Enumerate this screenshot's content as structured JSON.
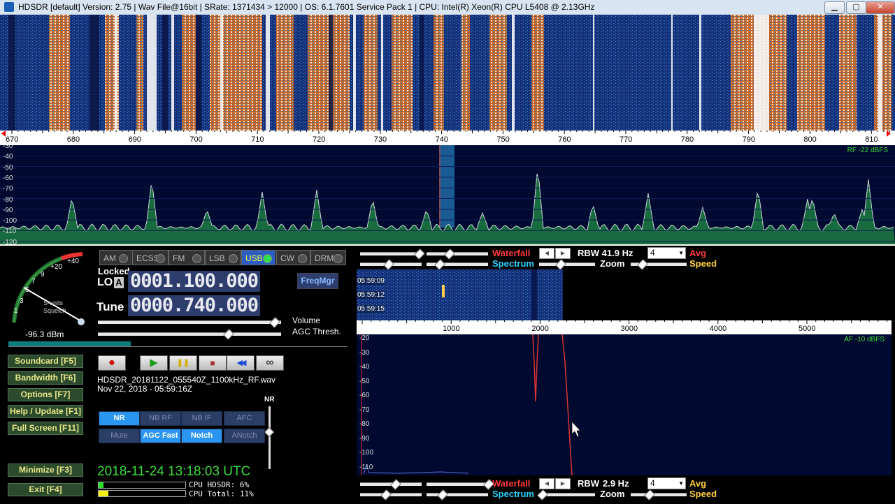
{
  "window": {
    "title": "HDSDR  [default]  Version: 2.75   |  Wav File@16bit  |  SRate: 1371434 > 12000   |  OS: 6.1.7601  Service Pack 1   |  CPU: Intel(R) Xeon(R) CPU          L5408  @ 2.13GHz",
    "min_label": "▁",
    "max_label": "▢",
    "close_label": "✕"
  },
  "freq_axis": {
    "ticks": [
      "670",
      "680",
      "690",
      "700",
      "710",
      "720",
      "730",
      "740",
      "750",
      "760",
      "770",
      "780",
      "790",
      "800",
      "810"
    ],
    "first_label": "670"
  },
  "spectrum": {
    "y_labels": [
      "-30",
      "-40",
      "-50",
      "-60",
      "-70",
      "-80",
      "-90",
      "-100",
      "-110",
      "-120"
    ],
    "rf_level": "RF -22 dBFS"
  },
  "smeter": {
    "scale": [
      "1",
      "3",
      "5",
      "7",
      "9",
      "+20",
      "+40"
    ],
    "caption_units": "S-units",
    "caption_squelch": "Squelch",
    "dbm": "-96.3 dBm"
  },
  "modes": [
    {
      "label": "AM",
      "active": false
    },
    {
      "label": "ECSS",
      "active": false
    },
    {
      "label": "FM",
      "active": false
    },
    {
      "label": "LSB",
      "active": false
    },
    {
      "label": "USB",
      "active": true
    },
    {
      "label": "CW",
      "active": false
    },
    {
      "label": "DRM",
      "active": false
    }
  ],
  "lo": {
    "status": "Locked",
    "label": "LO",
    "badge": "A",
    "value": "0001.100.000"
  },
  "tune": {
    "label": "Tune",
    "value": "0000.740.000"
  },
  "freqmgr": "FreqMgr",
  "volume_label": "Volume",
  "agc_label": "AGC Thresh.",
  "nav": [
    {
      "label": "Soundcard  [F5]"
    },
    {
      "label": "Bandwidth  [F6]"
    },
    {
      "label": "Options   [F7]"
    },
    {
      "label": "Help / Update  [F1]"
    },
    {
      "label": "Full Screen  [F11]"
    },
    {
      "label": "Minimize  [F3]"
    },
    {
      "label": "Exit      [F4]"
    }
  ],
  "transport": {
    "rec": "●",
    "play": "▶",
    "pause": "❚❚",
    "stop": "■",
    "rew": "◀◀",
    "loop": "∞"
  },
  "file": {
    "name": "HDSDR_20181122_055540Z_1100kHz_RF.wav",
    "time": "Nov 22, 2018 - 05:59:16Z"
  },
  "nr_label": "NR",
  "filters": [
    {
      "label": "NR",
      "on": true
    },
    {
      "label": "NB RF",
      "on": false
    },
    {
      "label": "NB IF",
      "on": false
    },
    {
      "label": "AFC",
      "on": false
    },
    {
      "label": "Mute",
      "on": false
    },
    {
      "label": "AGC Fast",
      "on": true
    },
    {
      "label": "Notch",
      "on": true
    },
    {
      "label": "ANotch",
      "on": false
    }
  ],
  "clock": "2018-11-24   13:18:03 UTC",
  "cpu": {
    "hdsdr_label": "CPU HDSDR:  6%",
    "total_label": "CPU Total:  11%",
    "hdsdr": 0.06,
    "total": 0.11
  },
  "rf_controls": {
    "waterfall": "Waterfall",
    "spectrum": "Spectrum",
    "rbw": "RBW 41.9 Hz",
    "zoom": "Zoom",
    "avg": "Avg",
    "speed": "Speed",
    "dropdown": "4"
  },
  "af_waterfall_times": [
    "05:59:09",
    "05:59:12",
    "05:59:15"
  ],
  "af_axis": [
    "1000",
    "2000",
    "3000",
    "4000",
    "5000"
  ],
  "af_spectrum": {
    "y_labels": [
      "-20",
      "-30",
      "-40",
      "-50",
      "-60",
      "-70",
      "-80",
      "-90",
      "-100",
      "-110"
    ],
    "af_level": "AF -10 dBFS"
  },
  "af_controls": {
    "waterfall": "Waterfall",
    "spectrum": "Spectrum",
    "rbw_label": "RBW",
    "rbw_value": "2.9 Hz",
    "zoom": "Zoom",
    "avg": "Avg",
    "speed": "Speed",
    "dropdown": "4"
  },
  "colors": {
    "accent": "#2a96f2",
    "spectrum_bg": "#000a30",
    "rf_green": "#3ddc3d",
    "waterfall_red": "#ff3a3a"
  }
}
